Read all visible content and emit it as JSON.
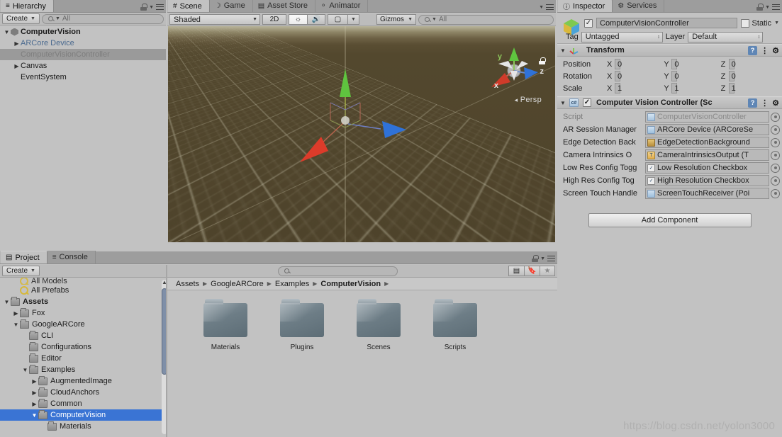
{
  "hierarchy": {
    "tab_label": "Hierarchy",
    "tab_icon": "hierarchy-icon",
    "create_label": "Create",
    "search_placeholder": "All",
    "items": [
      {
        "label": "ComputerVision",
        "depth": 0,
        "kind": "scene",
        "expanded": true,
        "selected": false
      },
      {
        "label": "ARCore Device",
        "depth": 1,
        "kind": "prefab",
        "expanded": false,
        "selected": false
      },
      {
        "label": "ComputerVisionController",
        "depth": 1,
        "kind": "gameobject",
        "expanded": null,
        "selected": true
      },
      {
        "label": "Canvas",
        "depth": 1,
        "kind": "gameobject",
        "expanded": false,
        "selected": false
      },
      {
        "label": "EventSystem",
        "depth": 1,
        "kind": "gameobject",
        "expanded": null,
        "selected": false
      }
    ]
  },
  "scene": {
    "tabs": [
      {
        "label": "Scene",
        "icon": "scene-grid-icon",
        "active": true
      },
      {
        "label": "Game",
        "icon": "game-pad-icon",
        "active": false
      },
      {
        "label": "Asset Store",
        "icon": "store-icon",
        "active": false
      },
      {
        "label": "Animator",
        "icon": "animator-icon",
        "active": false
      }
    ],
    "draw_mode": "Shaded",
    "mode_2d": "2D",
    "lighting_icon": "sun-icon",
    "audio_icon": "speaker-icon",
    "effects_icon": "image-icon",
    "gizmos_label": "Gizmos",
    "search_placeholder": "All",
    "perspective_label": "Persp",
    "axis_x": "x",
    "axis_y": "y",
    "axis_z": "z"
  },
  "inspector": {
    "tabs": [
      {
        "label": "Inspector",
        "icon": "info-icon",
        "active": true
      },
      {
        "label": "Services",
        "icon": "services-icon",
        "active": false
      }
    ],
    "object_name": "ComputerVisionController",
    "object_enabled": true,
    "static_label": "Static",
    "static_checked": false,
    "tag_label": "Tag",
    "tag_value": "Untagged",
    "layer_label": "Layer",
    "layer_value": "Default",
    "transform": {
      "title": "Transform",
      "icon": "transform-icon",
      "rows": [
        {
          "label": "Position",
          "x": "0",
          "y": "0",
          "z": "0"
        },
        {
          "label": "Rotation",
          "x": "0",
          "y": "0",
          "z": "0"
        },
        {
          "label": "Scale",
          "x": "1",
          "y": "1",
          "z": "1"
        }
      ],
      "axis_labels": [
        "X",
        "Y",
        "Z"
      ]
    },
    "script_component": {
      "title": "Computer Vision Controller (Sc",
      "icon": "cs-script-icon",
      "enabled": true,
      "fields": [
        {
          "label": "Script",
          "dim": true,
          "value": "ComputerVisionController",
          "icon": "cs-script-icon"
        },
        {
          "label": "AR Session Manager",
          "dim": false,
          "value": "ARCore Device (ARCoreSe",
          "icon": "gameobject-icon"
        },
        {
          "label": "Edge Detection Back",
          "dim": false,
          "value": "EdgeDetectionBackground",
          "icon": "texture-icon"
        },
        {
          "label": "Camera Intrinsics O",
          "dim": false,
          "value": "CameraIntrinsicsOutput (T",
          "icon": "text-icon"
        },
        {
          "label": "Low Res Config Togg",
          "dim": false,
          "value": "Low Resolution Checkbox",
          "icon": "toggle-icon"
        },
        {
          "label": "High Res Config Tog",
          "dim": false,
          "value": "High Resolution Checkbox",
          "icon": "toggle-icon"
        },
        {
          "label": "Screen Touch Handle",
          "dim": false,
          "value": "ScreenTouchReceiver (Poi",
          "icon": "gameobject-icon"
        }
      ]
    },
    "add_component_label": "Add Component"
  },
  "project": {
    "tabs": [
      {
        "label": "Project",
        "icon": "folder-icon",
        "active": true
      },
      {
        "label": "Console",
        "icon": "console-icon",
        "active": false
      }
    ],
    "create_label": "Create",
    "search_placeholder": "",
    "toolbar_icons": [
      "filter-type-icon",
      "filter-label-icon",
      "favorite-star-icon"
    ],
    "tree": [
      {
        "label": "All Models",
        "depth": 1,
        "kind": "saved-search",
        "expanded": null,
        "selected": false,
        "clipped": true
      },
      {
        "label": "All Prefabs",
        "depth": 1,
        "kind": "saved-search",
        "expanded": null,
        "selected": false
      },
      {
        "label": "Assets",
        "depth": 0,
        "kind": "folder",
        "expanded": true,
        "selected": false,
        "bold": true
      },
      {
        "label": "Fox",
        "depth": 1,
        "kind": "folder",
        "expanded": false,
        "selected": false
      },
      {
        "label": "GoogleARCore",
        "depth": 1,
        "kind": "folder",
        "expanded": true,
        "selected": false
      },
      {
        "label": "CLI",
        "depth": 2,
        "kind": "folder",
        "expanded": null,
        "selected": false
      },
      {
        "label": "Configurations",
        "depth": 2,
        "kind": "folder",
        "expanded": null,
        "selected": false
      },
      {
        "label": "Editor",
        "depth": 2,
        "kind": "folder",
        "expanded": null,
        "selected": false
      },
      {
        "label": "Examples",
        "depth": 2,
        "kind": "folder",
        "expanded": true,
        "selected": false
      },
      {
        "label": "AugmentedImage",
        "depth": 3,
        "kind": "folder",
        "expanded": false,
        "selected": false
      },
      {
        "label": "CloudAnchors",
        "depth": 3,
        "kind": "folder",
        "expanded": false,
        "selected": false
      },
      {
        "label": "Common",
        "depth": 3,
        "kind": "folder",
        "expanded": false,
        "selected": false
      },
      {
        "label": "ComputerVision",
        "depth": 3,
        "kind": "folder",
        "expanded": true,
        "selected": true
      },
      {
        "label": "Materials",
        "depth": 4,
        "kind": "folder",
        "expanded": null,
        "selected": false
      }
    ],
    "breadcrumb": [
      {
        "label": "Assets",
        "current": false
      },
      {
        "label": "GoogleARCore",
        "current": false
      },
      {
        "label": "Examples",
        "current": false
      },
      {
        "label": "ComputerVision",
        "current": true
      }
    ],
    "assets": [
      {
        "label": "Materials",
        "kind": "folder"
      },
      {
        "label": "Plugins",
        "kind": "folder"
      },
      {
        "label": "Scenes",
        "kind": "folder"
      },
      {
        "label": "Scripts",
        "kind": "folder"
      }
    ]
  },
  "watermark": "https://blog.csdn.net/yolon3000",
  "colors": {
    "panel_bg": "#c2c2c2",
    "tabbar_bg": "#9d9d9d",
    "selection_blue": "#3a74d4",
    "hierarchy_selection": "#9a9a9a",
    "prefab_blue": "#4b6a8f",
    "scene_ground": "#4e432b",
    "axis_x": "#d94141",
    "axis_y": "#59c442",
    "axis_z": "#3b7fd9"
  }
}
